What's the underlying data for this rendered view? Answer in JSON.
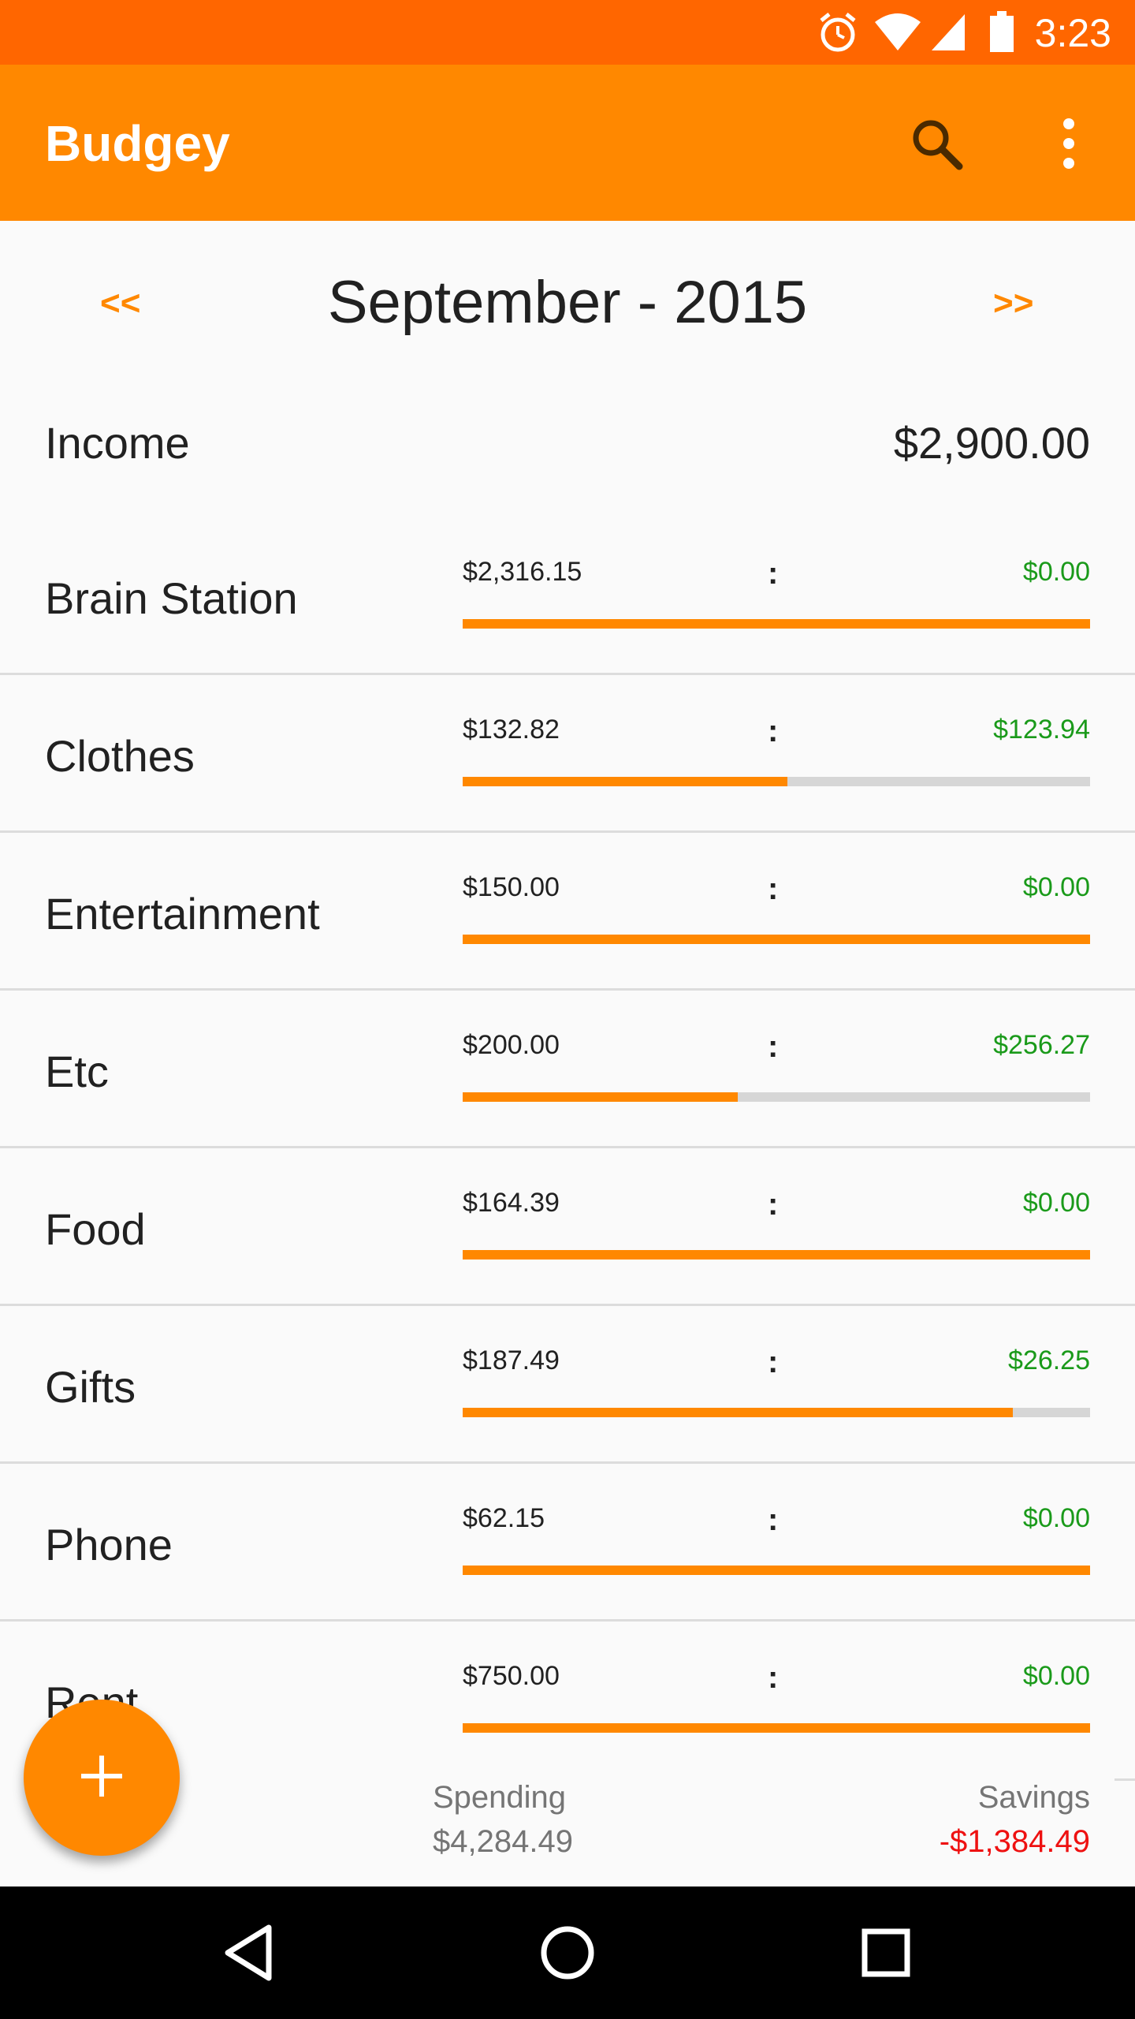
{
  "status_bar": {
    "time": "3:23",
    "icons": [
      "alarm-icon",
      "wifi-icon",
      "cell-signal-icon",
      "battery-icon"
    ]
  },
  "app_bar": {
    "title": "Budgey",
    "actions": [
      "search-icon",
      "more-vert-icon"
    ]
  },
  "month_nav": {
    "prev_label": "<<",
    "month": "September - 2015",
    "next_label": ">>"
  },
  "income": {
    "label": "Income",
    "value": "$2,900.00"
  },
  "categories": [
    {
      "name": "Brain Station",
      "budget": "$2,316.15",
      "separator": ":",
      "remaining": "$0.00",
      "progress": 1.0
    },
    {
      "name": "Clothes",
      "budget": "$132.82",
      "separator": ":",
      "remaining": "$123.94",
      "progress": 0.517
    },
    {
      "name": "Entertainment",
      "budget": "$150.00",
      "separator": ":",
      "remaining": "$0.00",
      "progress": 1.0
    },
    {
      "name": "Etc",
      "budget": "$200.00",
      "separator": ":",
      "remaining": "$256.27",
      "progress": 0.438
    },
    {
      "name": "Food",
      "budget": "$164.39",
      "separator": ":",
      "remaining": "$0.00",
      "progress": 1.0
    },
    {
      "name": "Gifts",
      "budget": "$187.49",
      "separator": ":",
      "remaining": "$26.25",
      "progress": 0.877
    },
    {
      "name": "Phone",
      "budget": "$62.15",
      "separator": ":",
      "remaining": "$0.00",
      "progress": 1.0
    },
    {
      "name": "Rent",
      "budget": "$750.00",
      "separator": ":",
      "remaining": "$0.00",
      "progress": 1.0
    }
  ],
  "summary": {
    "spending_label": "Spending",
    "spending_value": "$4,284.49",
    "savings_label": "Savings",
    "savings_value": "-$1,384.49"
  },
  "fab": {
    "icon": "add-icon"
  },
  "colors": {
    "status_bar": "#ff6600",
    "app_bar": "#ff8800",
    "accent": "#ff8800",
    "positive": "#1a9a1a",
    "negative": "#ee1111"
  },
  "nav_bar": {
    "buttons": [
      "back-icon",
      "home-icon",
      "recents-icon"
    ]
  }
}
